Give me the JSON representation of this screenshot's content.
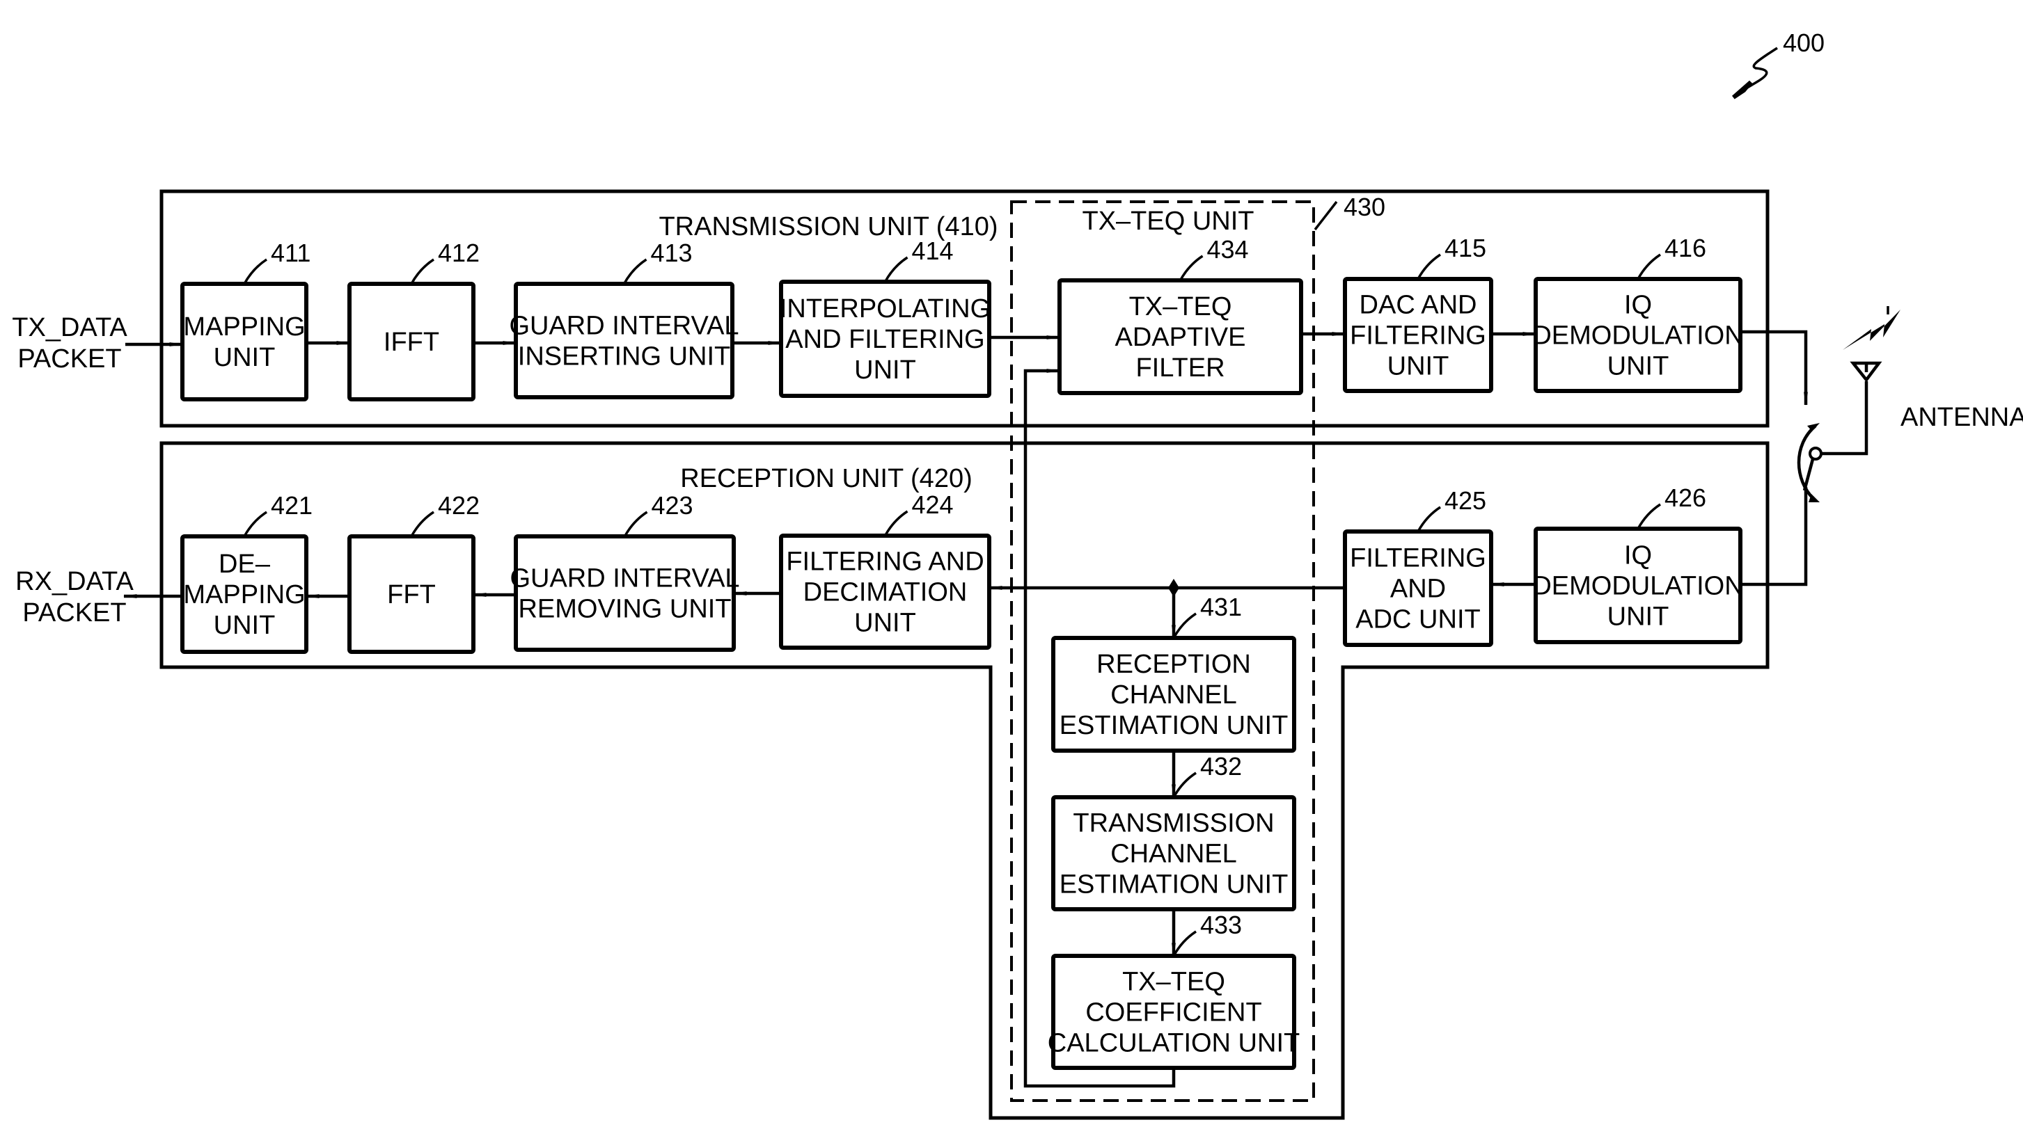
{
  "figure": {
    "ref": "400",
    "transmission_unit": {
      "title": "TRANSMISSION UNIT (410)"
    },
    "reception_unit": {
      "title": "RECEPTION UNIT  (420)"
    },
    "txteq_unit": {
      "title": "TX–TEQ UNIT",
      "ref": "430"
    },
    "inputs": {
      "tx": [
        "TX_DATA",
        "PACKET"
      ],
      "rx": [
        "RX_DATA",
        "PACKET"
      ],
      "antenna": "ANTENNA"
    },
    "tx_blocks": [
      {
        "ref": "411",
        "lines": [
          "MAPPING",
          "UNIT"
        ]
      },
      {
        "ref": "412",
        "lines": [
          "IFFT"
        ]
      },
      {
        "ref": "413",
        "lines": [
          "GUARD INTERVAL",
          "INSERTING UNIT"
        ]
      },
      {
        "ref": "414",
        "lines": [
          "INTERPOLATING",
          "AND FILTERING",
          "UNIT"
        ]
      },
      {
        "ref": "434",
        "lines": [
          "TX–TEQ",
          "ADAPTIVE",
          "FILTER"
        ]
      },
      {
        "ref": "415",
        "lines": [
          "DAC AND",
          "FILTERING",
          "UNIT"
        ]
      },
      {
        "ref": "416",
        "lines": [
          "IQ",
          "DEMODULATION",
          "UNIT"
        ]
      }
    ],
    "rx_blocks": [
      {
        "ref": "421",
        "lines": [
          "DE–",
          "MAPPING",
          "UNIT"
        ]
      },
      {
        "ref": "422",
        "lines": [
          "FFT"
        ]
      },
      {
        "ref": "423",
        "lines": [
          "GUARD INTERVAL",
          "REMOVING UNIT"
        ]
      },
      {
        "ref": "424",
        "lines": [
          "FILTERING AND",
          "DECIMATION",
          "UNIT"
        ]
      },
      {
        "ref": "425",
        "lines": [
          "FILTERING",
          "AND",
          "ADC UNIT"
        ]
      },
      {
        "ref": "426",
        "lines": [
          "IQ",
          "DEMODULATION",
          "UNIT"
        ]
      }
    ],
    "teq_blocks": [
      {
        "ref": "431",
        "lines": [
          "RECEPTION",
          "CHANNEL",
          "ESTIMATION UNIT"
        ]
      },
      {
        "ref": "432",
        "lines": [
          "TRANSMISSION",
          "CHANNEL",
          "ESTIMATION UNIT"
        ]
      },
      {
        "ref": "433",
        "lines": [
          "TX–TEQ",
          "COEFFICIENT",
          "CALCULATION UNIT"
        ]
      }
    ]
  }
}
